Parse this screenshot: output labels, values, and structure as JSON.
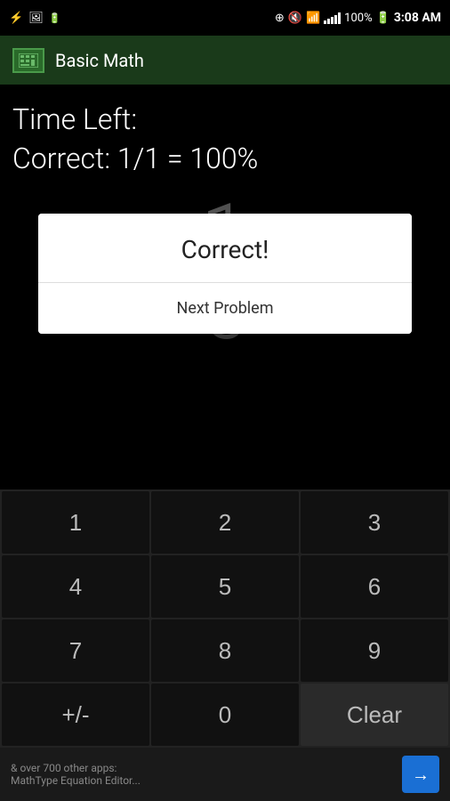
{
  "status_bar": {
    "time": "3:08 AM",
    "battery_pct": "100%"
  },
  "app_bar": {
    "title": "Basic Math"
  },
  "main": {
    "time_left_label": "Time Left:",
    "correct_label": "Correct: 1/1 = 100%",
    "big_number_1": "1",
    "big_number_2": "6"
  },
  "dialog": {
    "title": "Correct!",
    "button_label": "Next Problem"
  },
  "keypad": {
    "keys": [
      "1",
      "2",
      "3",
      "4",
      "5",
      "6",
      "7",
      "8",
      "9",
      "+/-",
      "0",
      "Clear"
    ]
  },
  "bottom_banner": {
    "text": "& over 700 other apps:",
    "subtitle": "MathType Equation Editor...",
    "arrow_label": "→"
  }
}
